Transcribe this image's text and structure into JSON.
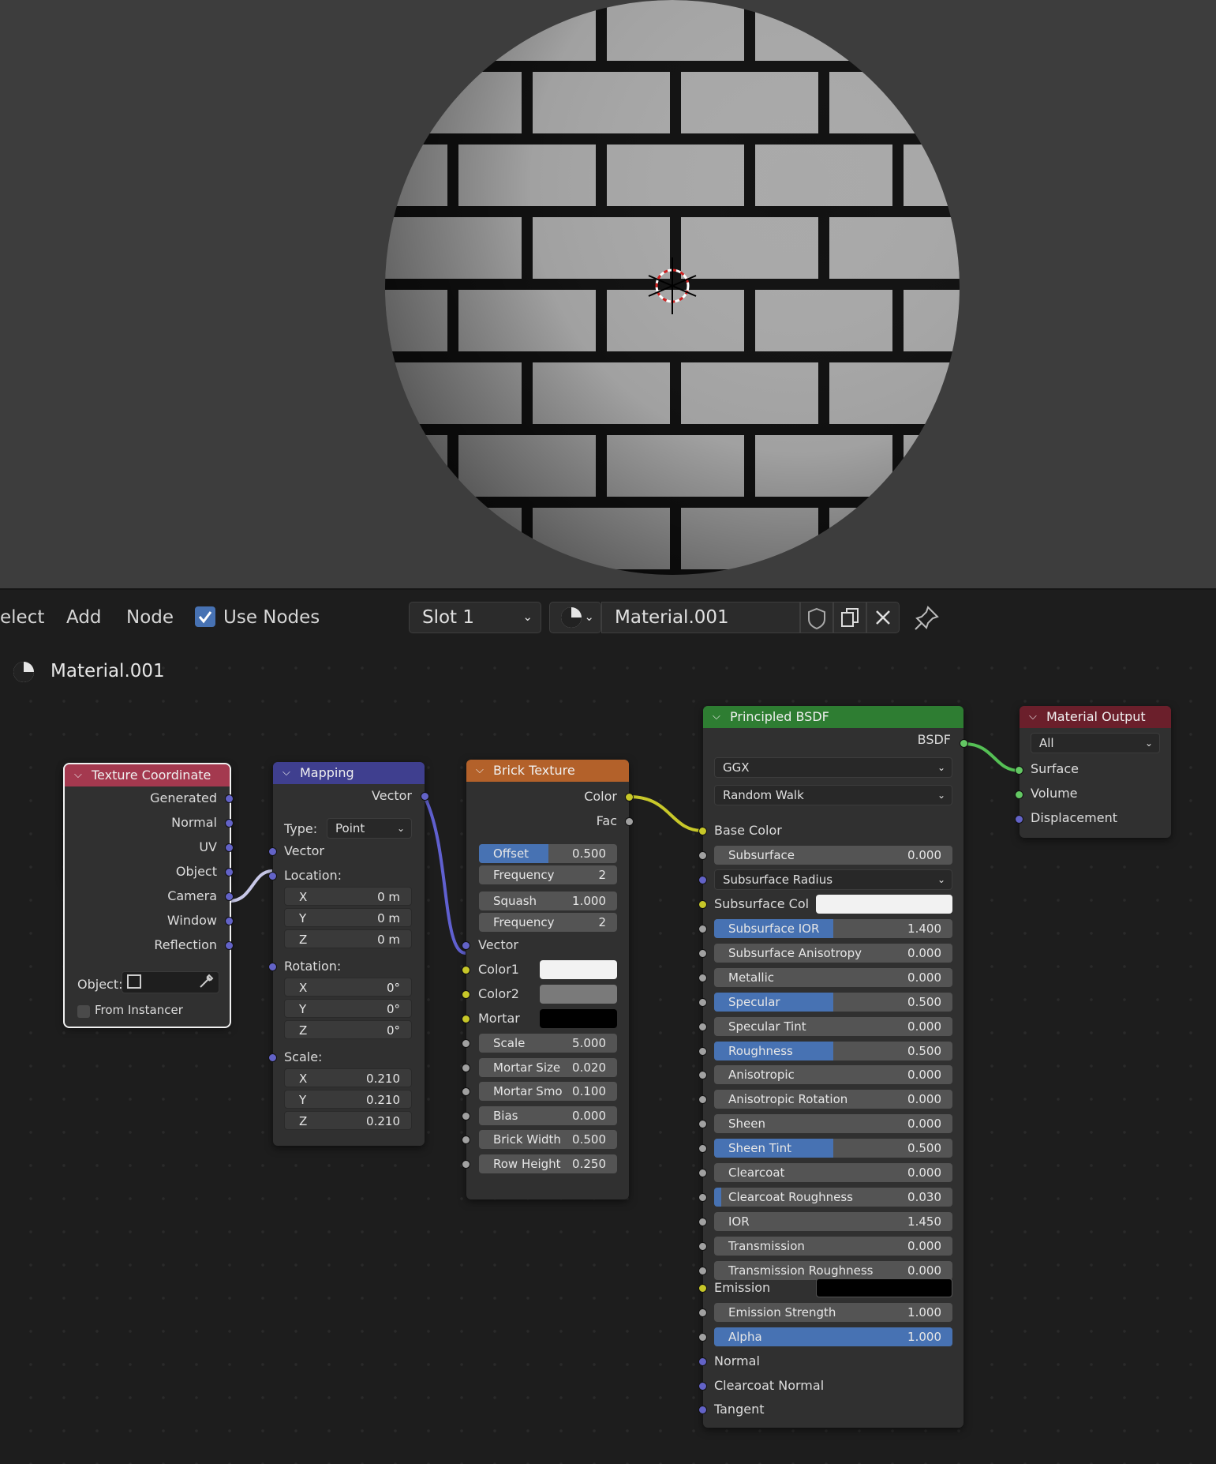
{
  "header": {
    "menu_select": "elect",
    "menu_add": "Add",
    "menu_node": "Node",
    "use_nodes_label": "Use Nodes",
    "use_nodes_checked": true,
    "slot": "Slot 1",
    "material_name": "Material.001"
  },
  "breadcrumb": {
    "material": "Material.001"
  },
  "nodes": {
    "texcoord": {
      "title": "Texture Coordinate",
      "outputs": [
        "Generated",
        "Normal",
        "UV",
        "Object",
        "Camera",
        "Window",
        "Reflection"
      ],
      "object_label": "Object:",
      "from_instancer": "From Instancer"
    },
    "mapping": {
      "title": "Mapping",
      "output": "Vector",
      "type_label": "Type:",
      "type_value": "Point",
      "input_vector": "Vector",
      "location_label": "Location:",
      "location": [
        {
          "axis": "X",
          "value": "0 m"
        },
        {
          "axis": "Y",
          "value": "0 m"
        },
        {
          "axis": "Z",
          "value": "0 m"
        }
      ],
      "rotation_label": "Rotation:",
      "rotation": [
        {
          "axis": "X",
          "value": "0°"
        },
        {
          "axis": "Y",
          "value": "0°"
        },
        {
          "axis": "Z",
          "value": "0°"
        }
      ],
      "scale_label": "Scale:",
      "scale": [
        {
          "axis": "X",
          "value": "0.210"
        },
        {
          "axis": "Y",
          "value": "0.210"
        },
        {
          "axis": "Z",
          "value": "0.210"
        }
      ]
    },
    "brick": {
      "title": "Brick Texture",
      "out_color": "Color",
      "out_fac": "Fac",
      "offset": {
        "label": "Offset",
        "value": "0.500",
        "fraction": 0.5
      },
      "frequency1": {
        "label": "Frequency",
        "value": "2"
      },
      "squash": {
        "label": "Squash",
        "value": "1.000"
      },
      "frequency2": {
        "label": "Frequency",
        "value": "2"
      },
      "in_vector": "Vector",
      "color1": "Color1",
      "color2": "Color2",
      "mortar": "Mortar",
      "color1_hex": "#f2f2f2",
      "color2_hex": "#7a7a7a",
      "mortar_hex": "#000000",
      "fields": [
        {
          "label": "Scale",
          "value": "5.000"
        },
        {
          "label": "Mortar Size",
          "value": "0.020"
        },
        {
          "label": "Mortar Smo",
          "value": "0.100"
        },
        {
          "label": "Bias",
          "value": "0.000"
        },
        {
          "label": "Brick Width",
          "value": "0.500"
        },
        {
          "label": "Row Height",
          "value": "0.250"
        }
      ]
    },
    "bsdf": {
      "title": "Principled BSDF",
      "output": "BSDF",
      "distribution": "GGX",
      "subsurface_method": "Random Walk",
      "base_color": "Base Color",
      "subsurface": {
        "label": "Subsurface",
        "value": "0.000",
        "fraction": 0
      },
      "subsurface_radius": "Subsurface Radius",
      "subsurface_col": "Subsurface Col",
      "subsurface_col_hex": "#f2f2f2",
      "fields": [
        {
          "label": "Subsurface IOR",
          "value": "1.400",
          "fraction": 0.5
        },
        {
          "label": "Subsurface Anisotropy",
          "value": "0.000",
          "fraction": 0
        },
        {
          "label": "Metallic",
          "value": "0.000",
          "fraction": 0
        },
        {
          "label": "Specular",
          "value": "0.500",
          "fraction": 0.5
        },
        {
          "label": "Specular Tint",
          "value": "0.000",
          "fraction": 0
        },
        {
          "label": "Roughness",
          "value": "0.500",
          "fraction": 0.5
        },
        {
          "label": "Anisotropic",
          "value": "0.000",
          "fraction": 0
        },
        {
          "label": "Anisotropic Rotation",
          "value": "0.000",
          "fraction": 0
        },
        {
          "label": "Sheen",
          "value": "0.000",
          "fraction": 0
        },
        {
          "label": "Sheen Tint",
          "value": "0.500",
          "fraction": 0.5
        },
        {
          "label": "Clearcoat",
          "value": "0.000",
          "fraction": 0
        },
        {
          "label": "Clearcoat Roughness",
          "value": "0.030",
          "fraction": 0.03
        },
        {
          "label": "IOR",
          "value": "1.450",
          "fraction": 0
        },
        {
          "label": "Transmission",
          "value": "0.000",
          "fraction": 0
        },
        {
          "label": "Transmission Roughness",
          "value": "0.000",
          "fraction": 0
        }
      ],
      "emission": "Emission",
      "emission_hex": "#000000",
      "emission_strength": {
        "label": "Emission Strength",
        "value": "1.000",
        "fraction": 0
      },
      "alpha": {
        "label": "Alpha",
        "value": "1.000",
        "fraction": 1
      },
      "normal": "Normal",
      "clearcoat_normal": "Clearcoat Normal",
      "tangent": "Tangent"
    },
    "output": {
      "title": "Material Output",
      "target": "All",
      "inputs": [
        "Surface",
        "Volume",
        "Displacement"
      ]
    }
  },
  "colors": {
    "header_texcoord": "#a4394f",
    "header_mapping": "#3f3f8f",
    "header_brick": "#b3612a",
    "header_bsdf": "#2e7d32",
    "header_output": "#6b1f2b",
    "accent": "#4772b3"
  }
}
